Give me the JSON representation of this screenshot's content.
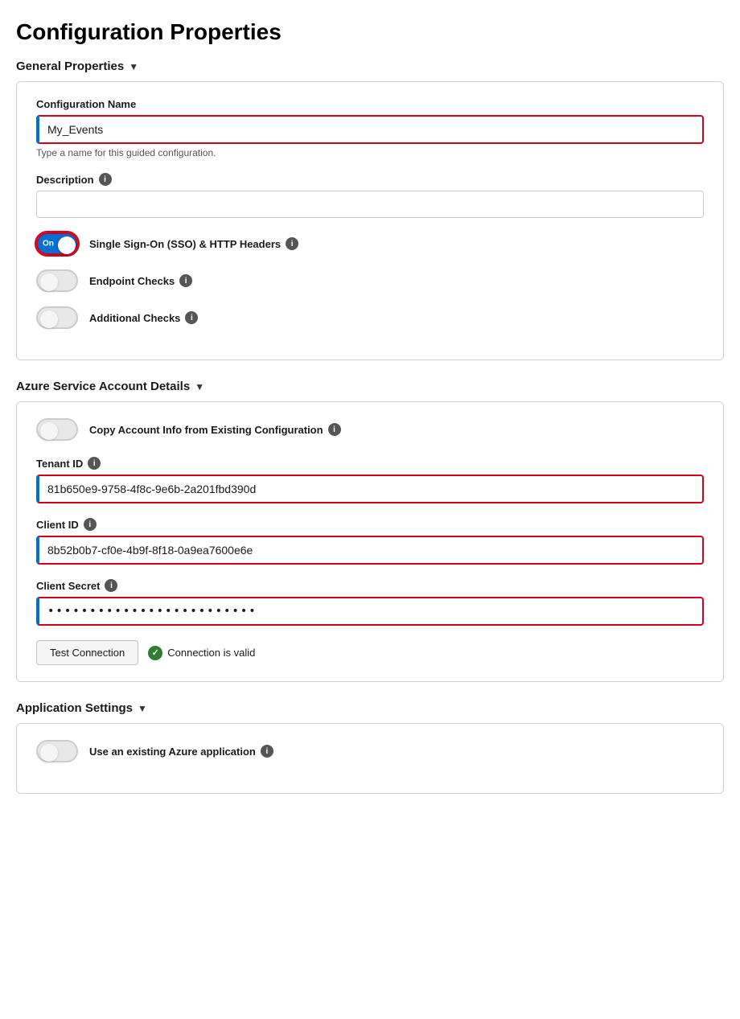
{
  "page": {
    "title": "Configuration Properties"
  },
  "general_properties": {
    "section_label": "General Properties",
    "chevron": "▼",
    "config_name": {
      "label": "Configuration Name",
      "value": "My_Events",
      "hint": "Type a name for this guided configuration."
    },
    "description": {
      "label": "Description",
      "info_label": "i",
      "value": "",
      "placeholder": ""
    },
    "sso_toggle": {
      "label": "Single Sign-On (SSO) & HTTP Headers",
      "info_label": "i",
      "state": "on",
      "text": "On"
    },
    "endpoint_toggle": {
      "label": "Endpoint Checks",
      "info_label": "i",
      "state": "off"
    },
    "additional_toggle": {
      "label": "Additional Checks",
      "info_label": "i",
      "state": "off"
    }
  },
  "azure_section": {
    "section_label": "Azure Service Account Details",
    "chevron": "▼",
    "copy_toggle": {
      "label": "Copy Account Info from Existing Configuration",
      "info_label": "i",
      "state": "off"
    },
    "tenant_id": {
      "label": "Tenant ID",
      "info_label": "i",
      "value": "81b650e9-9758-4f8c-9e6b-2a201fbd390d"
    },
    "client_id": {
      "label": "Client ID",
      "info_label": "i",
      "value": "8b52b0b7-cf0e-4b9f-8f18-0a9ea7600e6e"
    },
    "client_secret": {
      "label": "Client Secret",
      "info_label": "i",
      "value": "••••••••••••••••••••••••••••"
    },
    "test_button_label": "Test Connection",
    "connection_status": "Connection is valid"
  },
  "app_settings": {
    "section_label": "Application Settings",
    "chevron": "▼",
    "use_existing_toggle": {
      "label": "Use an existing Azure application",
      "info_label": "i",
      "state": "off"
    }
  }
}
